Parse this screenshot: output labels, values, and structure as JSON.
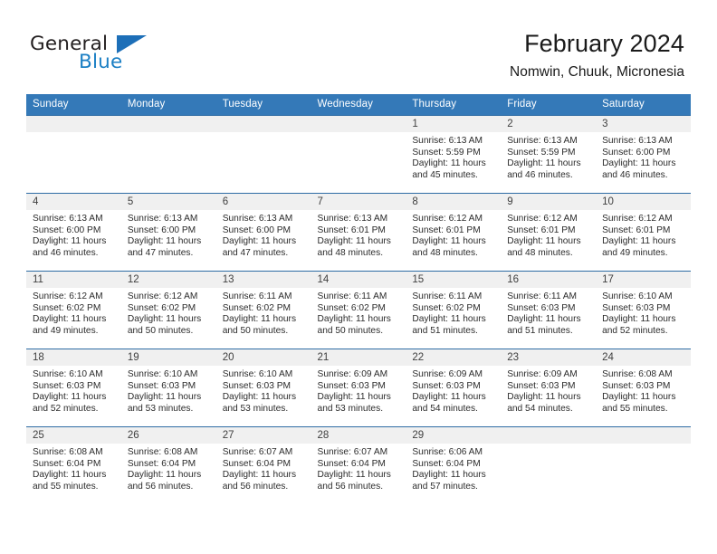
{
  "brand": {
    "name_part1": "General",
    "name_part2": "Blue",
    "flag_icon": "triangle-flag-icon"
  },
  "header": {
    "title": "February 2024",
    "location": "Nomwin, Chuuk, Micronesia"
  },
  "theme": {
    "header_blue": "#3479b8",
    "border_blue": "#2e6ca4",
    "date_band_gray": "#f0f0f0",
    "brand_blue": "#1b7fc4",
    "text_dark": "#2b2b2b"
  },
  "calendar": {
    "weekday_headers": [
      "Sunday",
      "Monday",
      "Tuesday",
      "Wednesday",
      "Thursday",
      "Friday",
      "Saturday"
    ],
    "weeks": [
      [
        {
          "day": "",
          "empty": true
        },
        {
          "day": "",
          "empty": true
        },
        {
          "day": "",
          "empty": true
        },
        {
          "day": "",
          "empty": true
        },
        {
          "day": "1",
          "sunrise": "Sunrise: 6:13 AM",
          "sunset": "Sunset: 5:59 PM",
          "daylight1": "Daylight: 11 hours",
          "daylight2": "and 45 minutes."
        },
        {
          "day": "2",
          "sunrise": "Sunrise: 6:13 AM",
          "sunset": "Sunset: 5:59 PM",
          "daylight1": "Daylight: 11 hours",
          "daylight2": "and 46 minutes."
        },
        {
          "day": "3",
          "sunrise": "Sunrise: 6:13 AM",
          "sunset": "Sunset: 6:00 PM",
          "daylight1": "Daylight: 11 hours",
          "daylight2": "and 46 minutes."
        }
      ],
      [
        {
          "day": "4",
          "sunrise": "Sunrise: 6:13 AM",
          "sunset": "Sunset: 6:00 PM",
          "daylight1": "Daylight: 11 hours",
          "daylight2": "and 46 minutes."
        },
        {
          "day": "5",
          "sunrise": "Sunrise: 6:13 AM",
          "sunset": "Sunset: 6:00 PM",
          "daylight1": "Daylight: 11 hours",
          "daylight2": "and 47 minutes."
        },
        {
          "day": "6",
          "sunrise": "Sunrise: 6:13 AM",
          "sunset": "Sunset: 6:00 PM",
          "daylight1": "Daylight: 11 hours",
          "daylight2": "and 47 minutes."
        },
        {
          "day": "7",
          "sunrise": "Sunrise: 6:13 AM",
          "sunset": "Sunset: 6:01 PM",
          "daylight1": "Daylight: 11 hours",
          "daylight2": "and 48 minutes."
        },
        {
          "day": "8",
          "sunrise": "Sunrise: 6:12 AM",
          "sunset": "Sunset: 6:01 PM",
          "daylight1": "Daylight: 11 hours",
          "daylight2": "and 48 minutes."
        },
        {
          "day": "9",
          "sunrise": "Sunrise: 6:12 AM",
          "sunset": "Sunset: 6:01 PM",
          "daylight1": "Daylight: 11 hours",
          "daylight2": "and 48 minutes."
        },
        {
          "day": "10",
          "sunrise": "Sunrise: 6:12 AM",
          "sunset": "Sunset: 6:01 PM",
          "daylight1": "Daylight: 11 hours",
          "daylight2": "and 49 minutes."
        }
      ],
      [
        {
          "day": "11",
          "sunrise": "Sunrise: 6:12 AM",
          "sunset": "Sunset: 6:02 PM",
          "daylight1": "Daylight: 11 hours",
          "daylight2": "and 49 minutes."
        },
        {
          "day": "12",
          "sunrise": "Sunrise: 6:12 AM",
          "sunset": "Sunset: 6:02 PM",
          "daylight1": "Daylight: 11 hours",
          "daylight2": "and 50 minutes."
        },
        {
          "day": "13",
          "sunrise": "Sunrise: 6:11 AM",
          "sunset": "Sunset: 6:02 PM",
          "daylight1": "Daylight: 11 hours",
          "daylight2": "and 50 minutes."
        },
        {
          "day": "14",
          "sunrise": "Sunrise: 6:11 AM",
          "sunset": "Sunset: 6:02 PM",
          "daylight1": "Daylight: 11 hours",
          "daylight2": "and 50 minutes."
        },
        {
          "day": "15",
          "sunrise": "Sunrise: 6:11 AM",
          "sunset": "Sunset: 6:02 PM",
          "daylight1": "Daylight: 11 hours",
          "daylight2": "and 51 minutes."
        },
        {
          "day": "16",
          "sunrise": "Sunrise: 6:11 AM",
          "sunset": "Sunset: 6:03 PM",
          "daylight1": "Daylight: 11 hours",
          "daylight2": "and 51 minutes."
        },
        {
          "day": "17",
          "sunrise": "Sunrise: 6:10 AM",
          "sunset": "Sunset: 6:03 PM",
          "daylight1": "Daylight: 11 hours",
          "daylight2": "and 52 minutes."
        }
      ],
      [
        {
          "day": "18",
          "sunrise": "Sunrise: 6:10 AM",
          "sunset": "Sunset: 6:03 PM",
          "daylight1": "Daylight: 11 hours",
          "daylight2": "and 52 minutes."
        },
        {
          "day": "19",
          "sunrise": "Sunrise: 6:10 AM",
          "sunset": "Sunset: 6:03 PM",
          "daylight1": "Daylight: 11 hours",
          "daylight2": "and 53 minutes."
        },
        {
          "day": "20",
          "sunrise": "Sunrise: 6:10 AM",
          "sunset": "Sunset: 6:03 PM",
          "daylight1": "Daylight: 11 hours",
          "daylight2": "and 53 minutes."
        },
        {
          "day": "21",
          "sunrise": "Sunrise: 6:09 AM",
          "sunset": "Sunset: 6:03 PM",
          "daylight1": "Daylight: 11 hours",
          "daylight2": "and 53 minutes."
        },
        {
          "day": "22",
          "sunrise": "Sunrise: 6:09 AM",
          "sunset": "Sunset: 6:03 PM",
          "daylight1": "Daylight: 11 hours",
          "daylight2": "and 54 minutes."
        },
        {
          "day": "23",
          "sunrise": "Sunrise: 6:09 AM",
          "sunset": "Sunset: 6:03 PM",
          "daylight1": "Daylight: 11 hours",
          "daylight2": "and 54 minutes."
        },
        {
          "day": "24",
          "sunrise": "Sunrise: 6:08 AM",
          "sunset": "Sunset: 6:03 PM",
          "daylight1": "Daylight: 11 hours",
          "daylight2": "and 55 minutes."
        }
      ],
      [
        {
          "day": "25",
          "sunrise": "Sunrise: 6:08 AM",
          "sunset": "Sunset: 6:04 PM",
          "daylight1": "Daylight: 11 hours",
          "daylight2": "and 55 minutes."
        },
        {
          "day": "26",
          "sunrise": "Sunrise: 6:08 AM",
          "sunset": "Sunset: 6:04 PM",
          "daylight1": "Daylight: 11 hours",
          "daylight2": "and 56 minutes."
        },
        {
          "day": "27",
          "sunrise": "Sunrise: 6:07 AM",
          "sunset": "Sunset: 6:04 PM",
          "daylight1": "Daylight: 11 hours",
          "daylight2": "and 56 minutes."
        },
        {
          "day": "28",
          "sunrise": "Sunrise: 6:07 AM",
          "sunset": "Sunset: 6:04 PM",
          "daylight1": "Daylight: 11 hours",
          "daylight2": "and 56 minutes."
        },
        {
          "day": "29",
          "sunrise": "Sunrise: 6:06 AM",
          "sunset": "Sunset: 6:04 PM",
          "daylight1": "Daylight: 11 hours",
          "daylight2": "and 57 minutes."
        },
        {
          "day": "",
          "empty": true
        },
        {
          "day": "",
          "empty": true
        }
      ]
    ]
  }
}
